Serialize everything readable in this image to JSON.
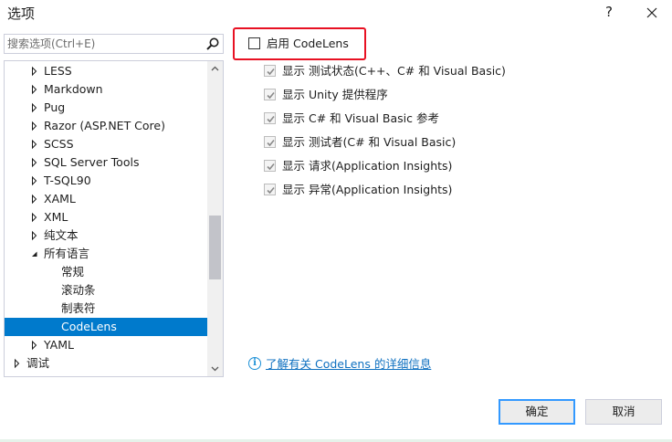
{
  "window": {
    "title": "选项",
    "help_label": "?",
    "close_icon": "close-icon"
  },
  "search": {
    "placeholder": "搜索选项(Ctrl+E)",
    "icon": "search-icon"
  },
  "tree": {
    "items": [
      {
        "label": "LESS",
        "expander": "collapsed"
      },
      {
        "label": "Markdown",
        "expander": "collapsed"
      },
      {
        "label": "Pug",
        "expander": "collapsed"
      },
      {
        "label": "Razor (ASP.NET Core)",
        "expander": "collapsed"
      },
      {
        "label": "SCSS",
        "expander": "collapsed"
      },
      {
        "label": "SQL Server Tools",
        "expander": "collapsed"
      },
      {
        "label": "T-SQL90",
        "expander": "collapsed"
      },
      {
        "label": "XAML",
        "expander": "collapsed"
      },
      {
        "label": "XML",
        "expander": "collapsed"
      },
      {
        "label": "纯文本",
        "expander": "collapsed"
      },
      {
        "label": "所有语言",
        "expander": "expanded"
      },
      {
        "label": "常规",
        "expander": "none"
      },
      {
        "label": "滚动条",
        "expander": "none"
      },
      {
        "label": "制表符",
        "expander": "none"
      },
      {
        "label": "CodeLens",
        "expander": "none",
        "selected": true
      },
      {
        "label": "YAML",
        "expander": "collapsed"
      },
      {
        "label": "调试",
        "expander": "collapsed"
      }
    ]
  },
  "codelens": {
    "enable_label": "启用 CodeLens",
    "enable_checked": false,
    "options": [
      {
        "label": "显示 测试状态(C++、C# 和 Visual Basic)",
        "checked": true
      },
      {
        "label": "显示 Unity 提供程序",
        "checked": true
      },
      {
        "label": "显示 C# 和 Visual Basic 参考",
        "checked": true
      },
      {
        "label": "显示 测试者(C# 和 Visual Basic)",
        "checked": true
      },
      {
        "label": "显示 请求(Application Insights)",
        "checked": true
      },
      {
        "label": "显示 异常(Application Insights)",
        "checked": true
      }
    ],
    "info_link": "了解有关 CodeLens 的详细信息"
  },
  "buttons": {
    "ok": "确定",
    "cancel": "取消"
  },
  "colors": {
    "selection": "#007acc",
    "highlight_border": "#e81123",
    "link": "#0e70c0"
  }
}
